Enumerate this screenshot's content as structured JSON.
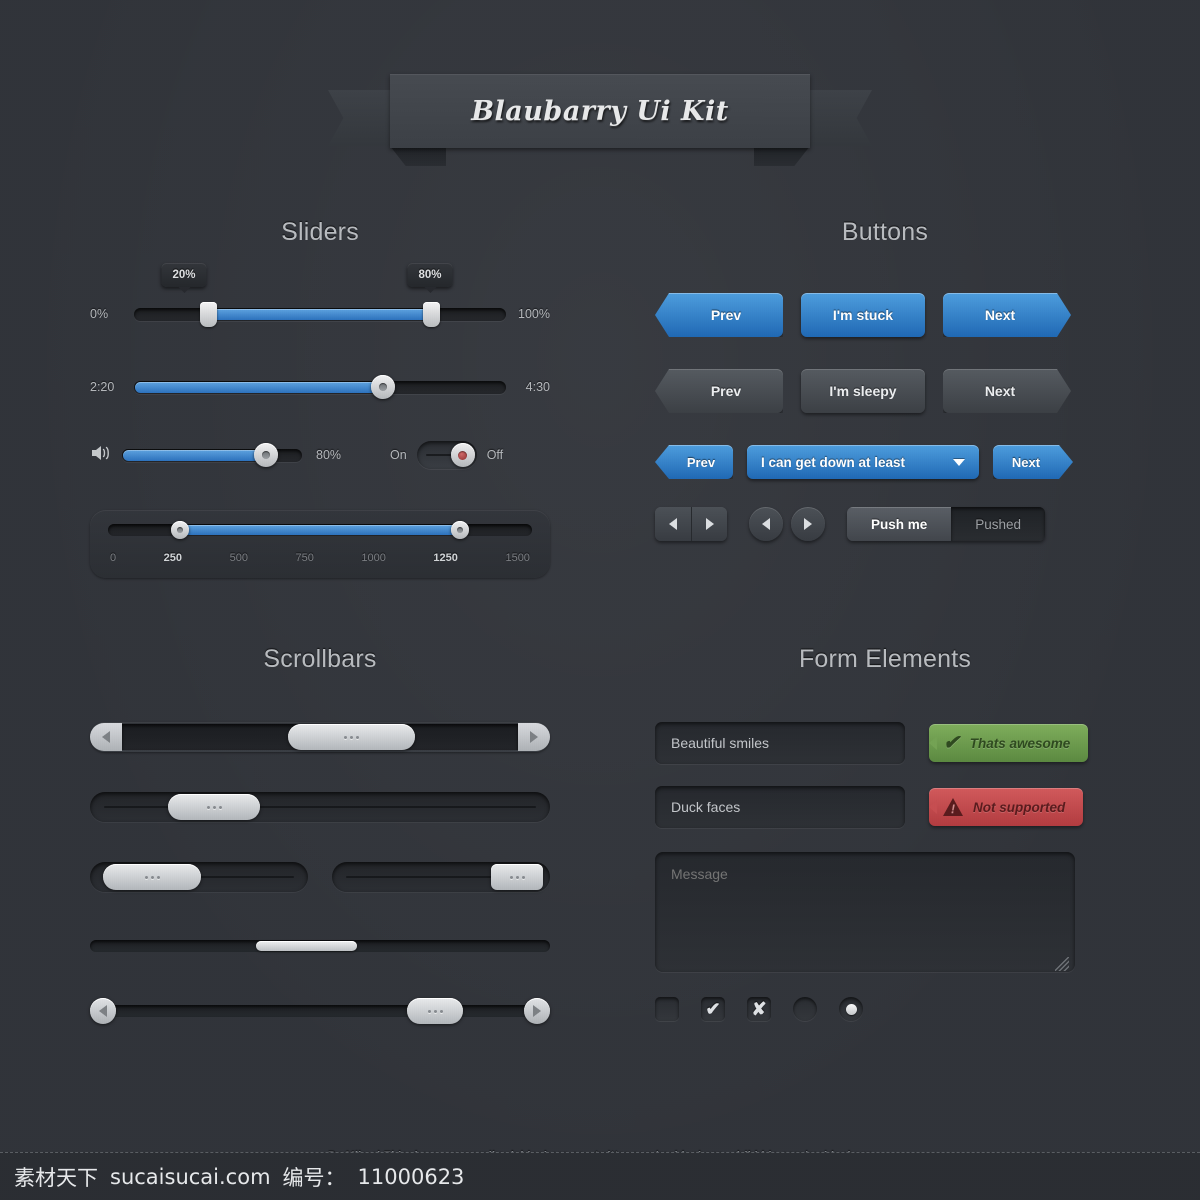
{
  "header": {
    "title": "Blaubarry Ui Kit"
  },
  "sections": {
    "sliders": "Sliders",
    "buttons": "Buttons",
    "scrollbars": "Scrollbars",
    "forms": "Form Elements"
  },
  "sliders": {
    "dual": {
      "min_label": "0%",
      "max_label": "100%",
      "tooltip_low": "20%",
      "tooltip_high": "80%",
      "low_pct": 20,
      "high_pct": 80
    },
    "time": {
      "start_label": "2:20",
      "end_label": "4:30",
      "value_pct": 67
    },
    "volume": {
      "icon": "speaker-icon",
      "value_label": "80%",
      "value_pct": 80
    },
    "toggle": {
      "on_label": "On",
      "off_label": "Off",
      "state": "off"
    },
    "range": {
      "ticks": [
        "0",
        "250",
        "500",
        "750",
        "1000",
        "1250",
        "1500"
      ],
      "active_ticks": [
        "250",
        "1250"
      ],
      "low_pct": 17,
      "high_pct": 83
    }
  },
  "buttons": {
    "row1": [
      {
        "label": "Prev",
        "style": "blue",
        "shape": "prev"
      },
      {
        "label": "I'm stuck",
        "style": "blue",
        "shape": "rect"
      },
      {
        "label": "Next",
        "style": "blue",
        "shape": "next"
      }
    ],
    "row2": [
      {
        "label": "Prev",
        "style": "gray",
        "shape": "prev"
      },
      {
        "label": "I'm sleepy",
        "style": "gray",
        "shape": "rect"
      },
      {
        "label": "Next",
        "style": "gray",
        "shape": "next"
      }
    ],
    "row3": {
      "prev_label": "Prev",
      "select_label": "I can get down at least",
      "next_label": "Next"
    },
    "row4": {
      "push_on_label": "Push me",
      "push_off_label": "Pushed"
    }
  },
  "scrollbars": {
    "bar1": {
      "thumb_left_pct": 42,
      "thumb_width_pct": 32
    },
    "bar2": {
      "thumb_left_pct": 17,
      "thumb_width_pct": 20
    },
    "bar3a": {
      "thumb_left_pct": 6,
      "thumb_width_pct": 45
    },
    "bar3b": {
      "thumb_left_pct": 73,
      "thumb_width_pct": 24
    },
    "bar4": {
      "thumb_left_pct": 36,
      "thumb_width_pct": 22
    },
    "bar5": {
      "thumb_left_pct": 69
    }
  },
  "forms": {
    "input1_value": "Beautiful smiles",
    "input2_value": "Duck faces",
    "textarea_placeholder": "Message",
    "badge_ok": "Thats awesome",
    "badge_err": "Not supported",
    "check_mark": "✔",
    "x_mark": "✘",
    "warn_mark": "!"
  },
  "footer": {
    "credit": "By  Mikael Eidenberg  -  www.mikaeleidenberg.se  -  twitter.com/meidenberg  -  dribbble.com/meidenberg"
  },
  "watermark": {
    "brand": "素材天下",
    "site": "sucaisucai.com",
    "id_label": "编号：",
    "id_value": "11000623"
  }
}
